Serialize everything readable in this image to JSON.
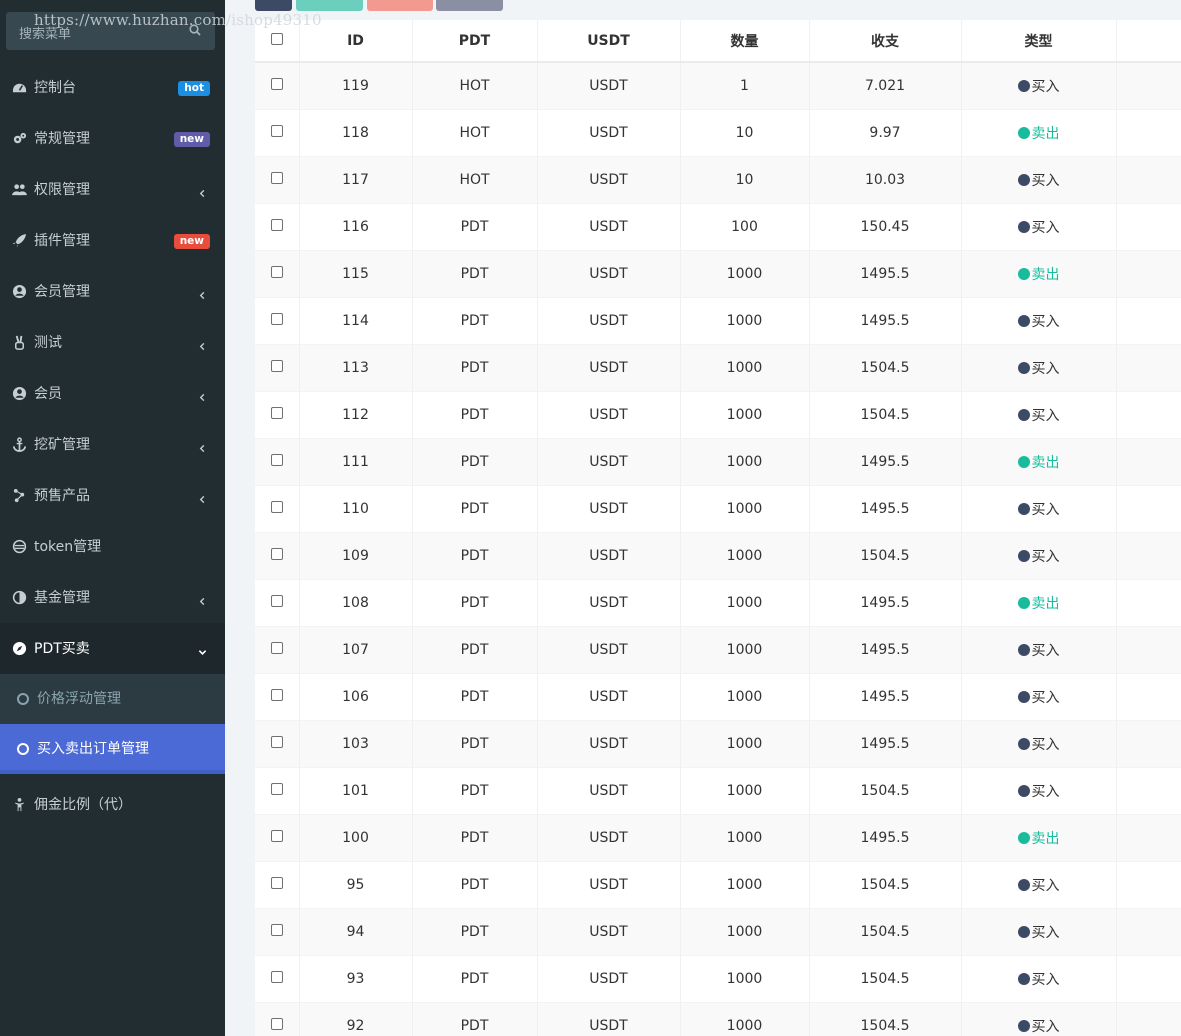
{
  "watermark": "https://www.huzhan.com/ishop49310",
  "search": {
    "placeholder": "搜索菜单"
  },
  "menu": [
    {
      "label": "控制台",
      "icon": "dashboard-icon",
      "badge": "hot",
      "badge_color": "#1d8fe2"
    },
    {
      "label": "常规管理",
      "icon": "cogs-icon",
      "badge": "new",
      "badge_color": "#605ca8"
    },
    {
      "label": "权限管理",
      "icon": "group-icon",
      "chevron": "left"
    },
    {
      "label": "插件管理",
      "icon": "rocket-icon",
      "badge": "new",
      "badge_color": "#e74c3c"
    },
    {
      "label": "会员管理",
      "icon": "user-circle-icon",
      "chevron": "left"
    },
    {
      "label": "测试",
      "icon": "hand-peace-icon",
      "chevron": "left"
    },
    {
      "label": "会员",
      "icon": "user-circle-icon",
      "chevron": "left"
    },
    {
      "label": "挖矿管理",
      "icon": "anchor-icon",
      "chevron": "left"
    },
    {
      "label": "预售产品",
      "icon": "connectdevelop-icon",
      "chevron": "left"
    },
    {
      "label": "token管理",
      "icon": "token-icon"
    },
    {
      "label": "基金管理",
      "icon": "half-circle-icon",
      "chevron": "left"
    },
    {
      "label": "PDT买卖",
      "icon": "compass-icon",
      "chevron": "down",
      "active": true
    }
  ],
  "submenu": [
    {
      "label": "价格浮动管理"
    },
    {
      "label": "买入卖出订单管理",
      "selected": true
    }
  ],
  "menu_last": {
    "label": "佣金比例（代）",
    "icon": "child-icon"
  },
  "toolbar_colors": [
    "#3d4a66",
    "#6ccfbd",
    "#f39a90",
    "#8a8fa3"
  ],
  "table": {
    "headers": [
      "ID",
      "PDT",
      "USDT",
      "数量",
      "收支",
      "类型"
    ],
    "rows": [
      {
        "id": "119",
        "pdt": "HOT",
        "usdt": "USDT",
        "qty": "1",
        "amount": "7.021",
        "type": "买入"
      },
      {
        "id": "118",
        "pdt": "HOT",
        "usdt": "USDT",
        "qty": "10",
        "amount": "9.97",
        "type": "卖出"
      },
      {
        "id": "117",
        "pdt": "HOT",
        "usdt": "USDT",
        "qty": "10",
        "amount": "10.03",
        "type": "买入"
      },
      {
        "id": "116",
        "pdt": "PDT",
        "usdt": "USDT",
        "qty": "100",
        "amount": "150.45",
        "type": "买入"
      },
      {
        "id": "115",
        "pdt": "PDT",
        "usdt": "USDT",
        "qty": "1000",
        "amount": "1495.5",
        "type": "卖出"
      },
      {
        "id": "114",
        "pdt": "PDT",
        "usdt": "USDT",
        "qty": "1000",
        "amount": "1495.5",
        "type": "买入"
      },
      {
        "id": "113",
        "pdt": "PDT",
        "usdt": "USDT",
        "qty": "1000",
        "amount": "1504.5",
        "type": "买入"
      },
      {
        "id": "112",
        "pdt": "PDT",
        "usdt": "USDT",
        "qty": "1000",
        "amount": "1504.5",
        "type": "买入"
      },
      {
        "id": "111",
        "pdt": "PDT",
        "usdt": "USDT",
        "qty": "1000",
        "amount": "1495.5",
        "type": "卖出"
      },
      {
        "id": "110",
        "pdt": "PDT",
        "usdt": "USDT",
        "qty": "1000",
        "amount": "1495.5",
        "type": "买入"
      },
      {
        "id": "109",
        "pdt": "PDT",
        "usdt": "USDT",
        "qty": "1000",
        "amount": "1504.5",
        "type": "买入"
      },
      {
        "id": "108",
        "pdt": "PDT",
        "usdt": "USDT",
        "qty": "1000",
        "amount": "1495.5",
        "type": "卖出"
      },
      {
        "id": "107",
        "pdt": "PDT",
        "usdt": "USDT",
        "qty": "1000",
        "amount": "1495.5",
        "type": "买入"
      },
      {
        "id": "106",
        "pdt": "PDT",
        "usdt": "USDT",
        "qty": "1000",
        "amount": "1495.5",
        "type": "买入"
      },
      {
        "id": "103",
        "pdt": "PDT",
        "usdt": "USDT",
        "qty": "1000",
        "amount": "1495.5",
        "type": "买入"
      },
      {
        "id": "101",
        "pdt": "PDT",
        "usdt": "USDT",
        "qty": "1000",
        "amount": "1504.5",
        "type": "买入"
      },
      {
        "id": "100",
        "pdt": "PDT",
        "usdt": "USDT",
        "qty": "1000",
        "amount": "1495.5",
        "type": "卖出"
      },
      {
        "id": "95",
        "pdt": "PDT",
        "usdt": "USDT",
        "qty": "1000",
        "amount": "1504.5",
        "type": "买入"
      },
      {
        "id": "94",
        "pdt": "PDT",
        "usdt": "USDT",
        "qty": "1000",
        "amount": "1504.5",
        "type": "买入"
      },
      {
        "id": "93",
        "pdt": "PDT",
        "usdt": "USDT",
        "qty": "1000",
        "amount": "1504.5",
        "type": "买入"
      },
      {
        "id": "92",
        "pdt": "PDT",
        "usdt": "USDT",
        "qty": "1000",
        "amount": "1504.5",
        "type": "买入"
      }
    ]
  },
  "type_colors": {
    "买入": "#3d4a66",
    "卖出": "#18bc9c"
  }
}
